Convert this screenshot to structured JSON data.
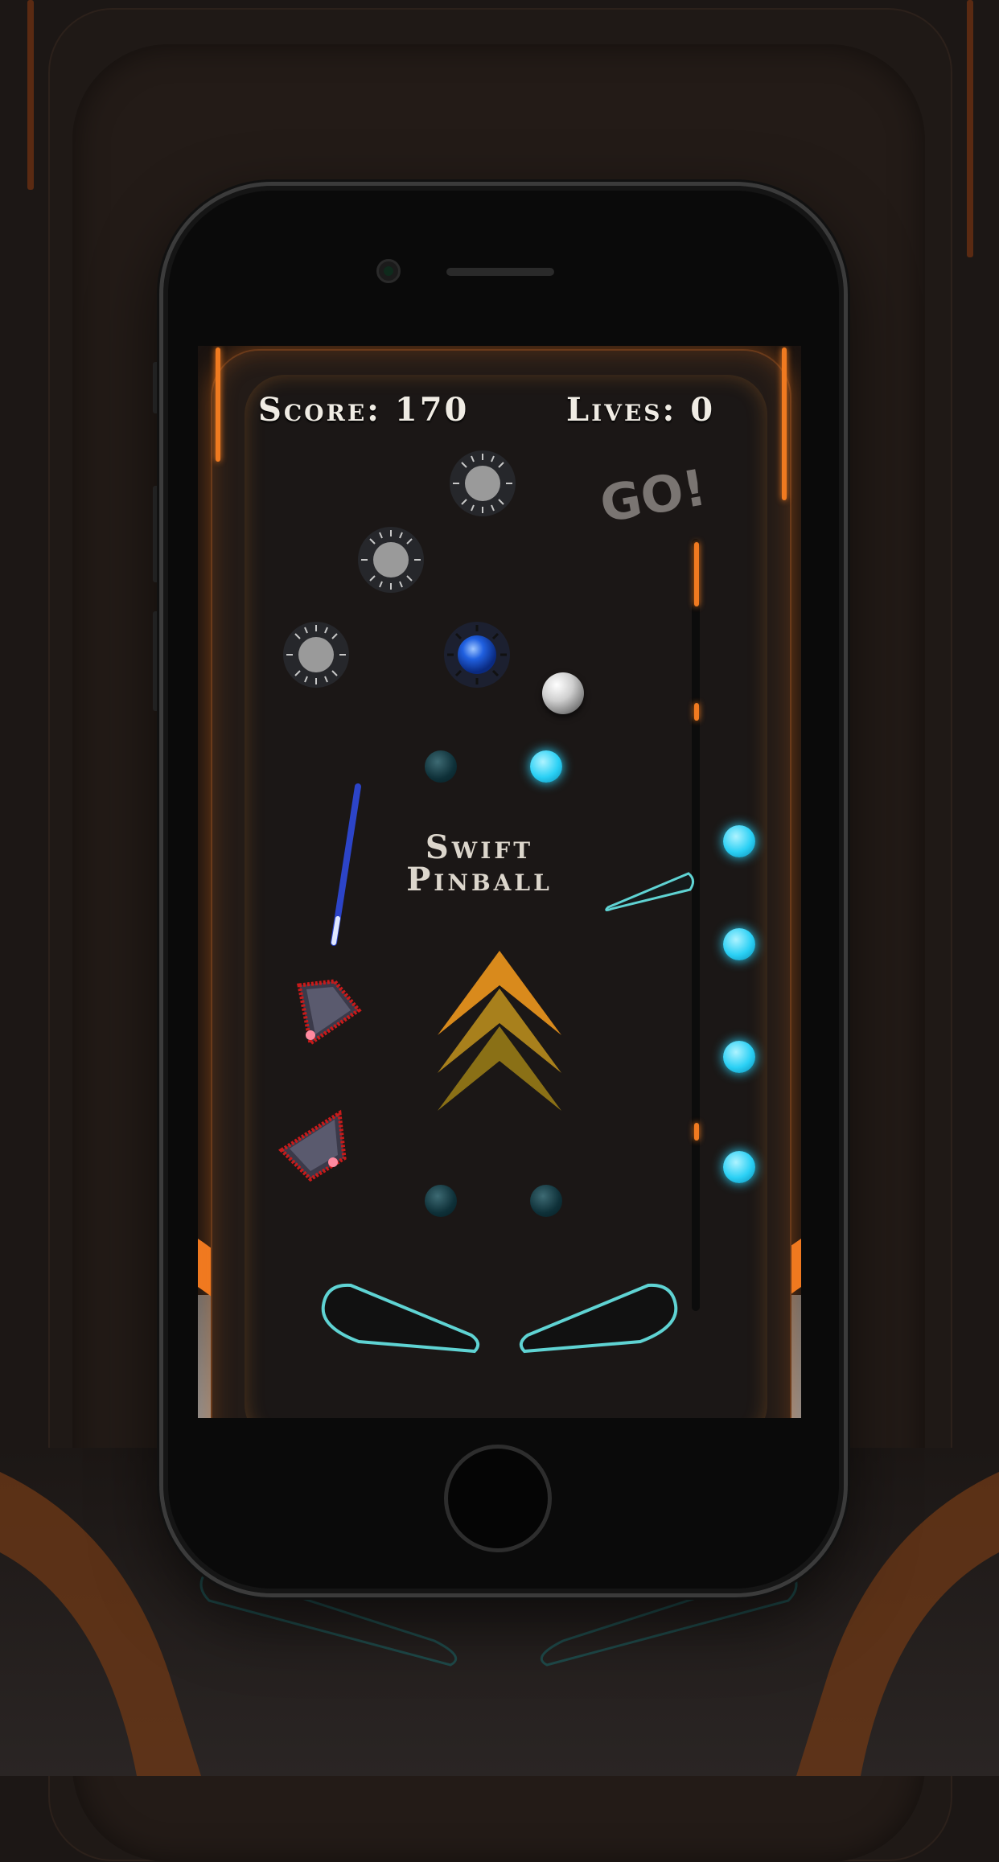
{
  "hud": {
    "score_label": "Score: 170",
    "lives_label": "Lives: 0"
  },
  "banner": {
    "go": "GO!"
  },
  "title": {
    "line1": "Swift",
    "line2": "Pinball"
  },
  "game": {
    "score": 170,
    "lives": 0,
    "active_bumper": "bumper-4"
  },
  "colors": {
    "accent_orange": "#f07a20",
    "light_on": "#2ad0f5",
    "bumper_active": "#2060e0",
    "flipper_outline": "#5fd3d3"
  },
  "icons": {
    "bumper": "starburst-bumper-icon",
    "slingshot": "triangle-slingshot-icon",
    "arrows": "chevron-up-arrows-icon"
  }
}
